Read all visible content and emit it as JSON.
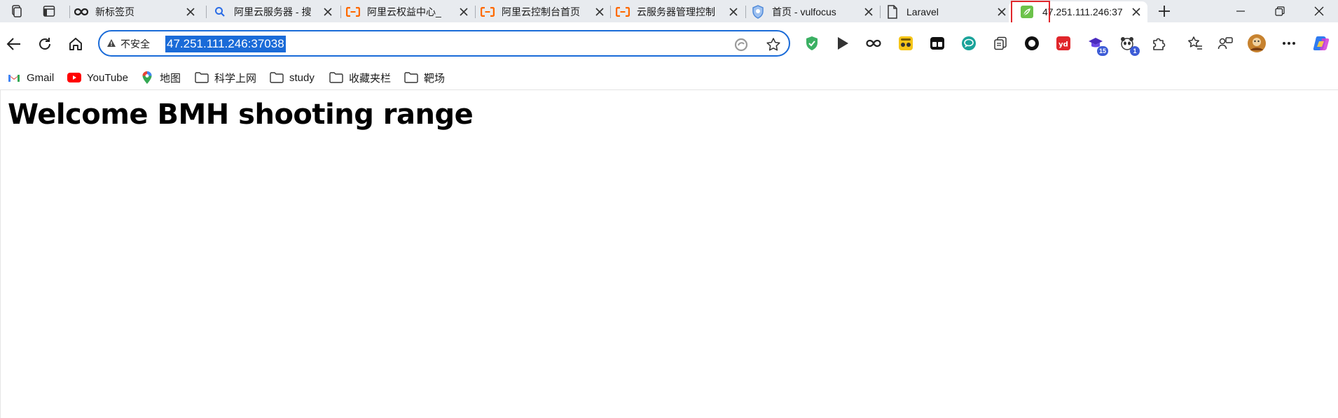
{
  "tabs": [
    {
      "title": "新标签页",
      "icon": "infinity-icon"
    },
    {
      "title": "阿里云服务器 - 搜",
      "icon": "search-icon"
    },
    {
      "title": "阿里云权益中心_",
      "icon": "aliyun-icon"
    },
    {
      "title": "阿里云控制台首页",
      "icon": "aliyun-icon"
    },
    {
      "title": "云服务器管理控制",
      "icon": "aliyun-icon"
    },
    {
      "title": "首页 - vulfocus",
      "icon": "shield-icon"
    },
    {
      "title": "Laravel",
      "icon": "document-icon"
    },
    {
      "title": "47.251.111.246:37",
      "icon": "leaf-icon",
      "active": true
    }
  ],
  "address_bar": {
    "security_label": "不安全",
    "url": "47.251.111.246:37038"
  },
  "extensions": [
    {
      "icon": "adguard-shield-icon"
    },
    {
      "icon": "play-icon"
    },
    {
      "icon": "infinity-icon"
    },
    {
      "icon": "tampermonkey-icon"
    },
    {
      "icon": "tab-manager-icon"
    },
    {
      "icon": "chat-bubble-icon"
    },
    {
      "icon": "collections-icon"
    },
    {
      "icon": "record-icon"
    },
    {
      "icon": "youdao-icon"
    },
    {
      "icon": "graduation-cap-icon",
      "badge": "15"
    },
    {
      "icon": "panda-icon",
      "badge": "1"
    },
    {
      "icon": "puzzle-icon"
    },
    {
      "icon": "favorites-icon"
    },
    {
      "icon": "share-icon"
    },
    {
      "icon": "avatar-icon"
    },
    {
      "icon": "more-icon"
    },
    {
      "icon": "copilot-icon"
    }
  ],
  "bookmarks": [
    {
      "label": "Gmail",
      "icon": "gmail-icon"
    },
    {
      "label": "YouTube",
      "icon": "youtube-icon"
    },
    {
      "label": "地图",
      "icon": "maps-pin-icon"
    },
    {
      "label": "科学上网",
      "icon": "folder-icon"
    },
    {
      "label": "study",
      "icon": "folder-icon"
    },
    {
      "label": "收藏夹栏",
      "icon": "folder-icon"
    },
    {
      "label": "靶场",
      "icon": "folder-icon"
    }
  ],
  "page": {
    "heading": "Welcome BMH shooting range"
  },
  "colors": {
    "accent": "#1a6bd8",
    "tabstrip_bg": "#e8ebef",
    "highlight_box": "#e0262b",
    "aliyun_orange": "#ff6a00"
  }
}
